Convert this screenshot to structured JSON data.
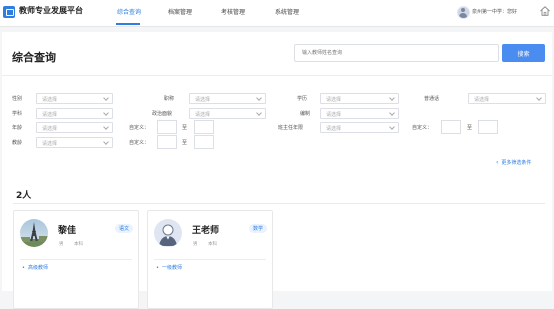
{
  "header": {
    "app_title": "教师专业发展平台",
    "nav": [
      {
        "label": "综合查询",
        "active": true
      },
      {
        "label": "档案管理",
        "active": false
      },
      {
        "label": "考核管理",
        "active": false
      },
      {
        "label": "系统管理",
        "active": false
      }
    ],
    "user_text": "泉州第一中学：您好",
    "icons": {
      "logo": "platform-logo-icon",
      "avatar": "user-avatar-icon",
      "home": "home-icon"
    }
  },
  "search": {
    "title": "综合查询",
    "placeholder": "输入教师姓名查询",
    "button": "搜索"
  },
  "filters": {
    "select_placeholder": "请选择",
    "gender": "性别",
    "title_rank": "职称",
    "education": "学历",
    "mandarin": "普通话",
    "discipline": "学科",
    "political": "政治面貌",
    "staffing": "编制",
    "age": "年龄",
    "custom": "自定义：",
    "to": "至",
    "head_teacher_years": "班主任年限",
    "teaching_age": "教龄"
  },
  "more_filters": "更多筛选条件",
  "results": {
    "count_label": "2人",
    "teachers": [
      {
        "name": "黎佳",
        "subject": "语文",
        "gender": "男",
        "education": "本科",
        "level": "高级教师"
      },
      {
        "name": "王老师",
        "subject": "数学",
        "gender": "男",
        "education": "本科",
        "level": "一级教师"
      }
    ]
  },
  "colors": {
    "accent": "#2f7de1",
    "button": "#4a8cf0"
  }
}
